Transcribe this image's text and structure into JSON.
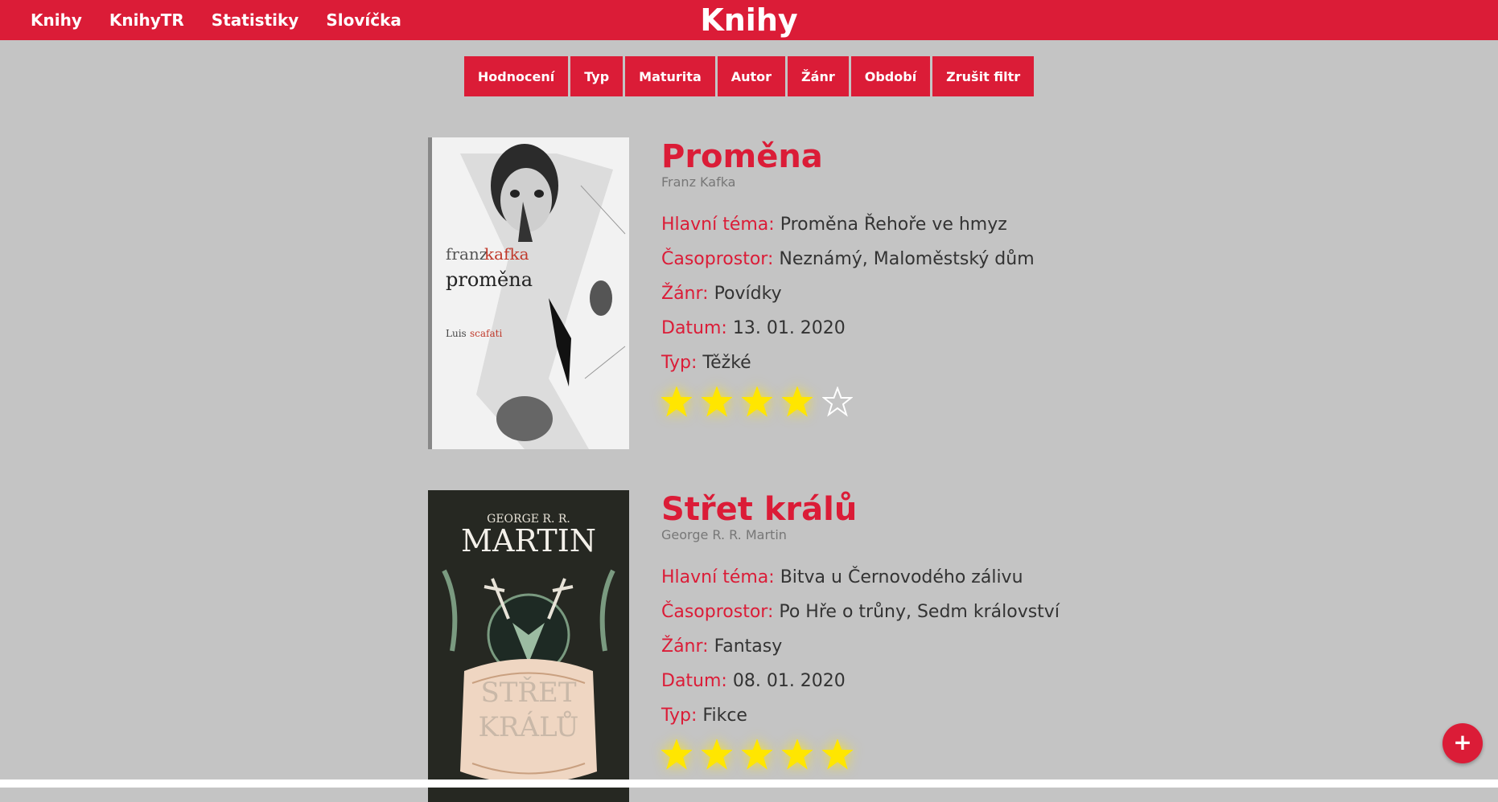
{
  "nav": {
    "items": [
      "Knihy",
      "KnihyTR",
      "Statistiky",
      "Slovíčka"
    ]
  },
  "site_title": "Knihy",
  "filters": [
    "Hodnocení",
    "Typ",
    "Maturita",
    "Autor",
    "Žánr",
    "Období",
    "Zrušit filtr"
  ],
  "labels": {
    "theme": "Hlavní téma:",
    "setting": "Časoprostor:",
    "genre": "Žánr:",
    "date": "Datum:",
    "type": "Typ:"
  },
  "books": [
    {
      "title": "Proměna",
      "author": "Franz Kafka",
      "theme": "Proměna Řehoře ve hmyz",
      "setting": "Neznámý, Maloměstský dům",
      "genre": "Povídky",
      "date": "13. 01. 2020",
      "type": "Těžké",
      "rating": 4,
      "max_rating": 5,
      "cover": {
        "line1a": "franz",
        "line1b": "kafka",
        "line2": "proměna",
        "line3a": "Luis",
        "line3b": "scafati"
      }
    },
    {
      "title": "Střet králů",
      "author": "George R. R. Martin",
      "theme": "Bitva u Černovodého zálivu",
      "setting": "Po Hře o trůny, Sedm království",
      "genre": "Fantasy",
      "date": "08. 01. 2020",
      "type": "Fikce",
      "rating": 5,
      "max_rating": 5,
      "cover": {
        "author_top": "GEORGE R. R.",
        "author_big": "MARTIN",
        "title1": "STŘET",
        "title2": "KRÁLŮ"
      }
    }
  ],
  "fab_label": "+",
  "colors": {
    "accent": "#db1c37",
    "star": "#ffe600",
    "background": "#c4c4c4"
  }
}
